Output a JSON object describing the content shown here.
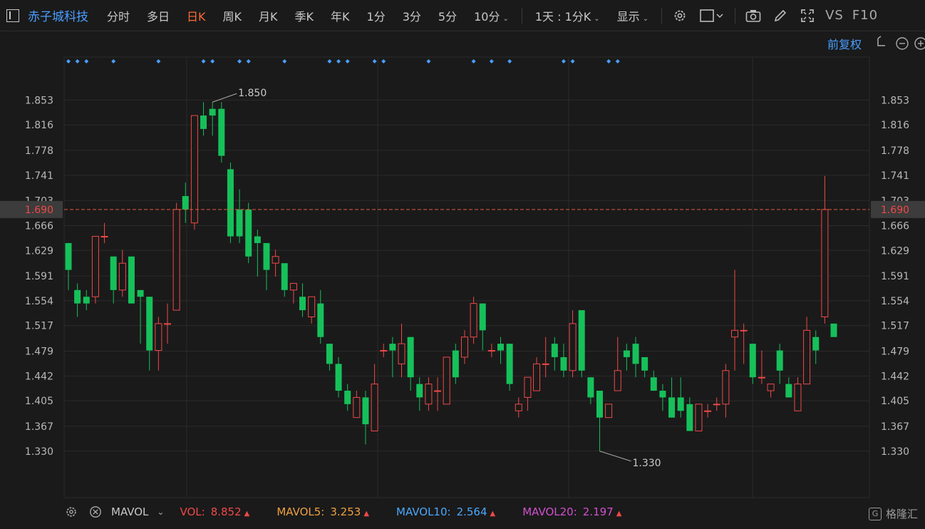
{
  "toolbar": {
    "stock_name": "赤子城科技",
    "periods": [
      "分时",
      "多日",
      "日K",
      "周K",
      "月K",
      "季K",
      "年K",
      "1分",
      "3分",
      "5分",
      "10分"
    ],
    "active_period": "日K",
    "range_select": "1天 : 1分K",
    "display_label": "显示",
    "vs_label": "VS",
    "f10_label": "F10"
  },
  "chart_header": {
    "adjust_label": "前复权"
  },
  "chart_data": {
    "type": "candlestick",
    "y_ticks": [
      1.33,
      1.367,
      1.405,
      1.442,
      1.479,
      1.517,
      1.554,
      1.591,
      1.629,
      1.666,
      1.703,
      1.741,
      1.778,
      1.816,
      1.853
    ],
    "ylim": [
      1.3,
      1.88
    ],
    "current_price": 1.69,
    "current_price_label": "1.690",
    "high_label": "1.850",
    "low_label": "1.330",
    "grid": true,
    "candles": [
      {
        "o": 1.64,
        "h": 1.64,
        "l": 1.57,
        "c": 1.6
      },
      {
        "o": 1.57,
        "h": 1.58,
        "l": 1.53,
        "c": 1.55
      },
      {
        "o": 1.56,
        "h": 1.57,
        "l": 1.54,
        "c": 1.55
      },
      {
        "o": 1.56,
        "h": 1.65,
        "l": 1.55,
        "c": 1.65
      },
      {
        "o": 1.65,
        "h": 1.67,
        "l": 1.64,
        "c": 1.65
      },
      {
        "o": 1.62,
        "h": 1.62,
        "l": 1.55,
        "c": 1.57
      },
      {
        "o": 1.57,
        "h": 1.63,
        "l": 1.56,
        "c": 1.61
      },
      {
        "o": 1.62,
        "h": 1.62,
        "l": 1.55,
        "c": 1.55
      },
      {
        "o": 1.57,
        "h": 1.57,
        "l": 1.49,
        "c": 1.56
      },
      {
        "o": 1.56,
        "h": 1.56,
        "l": 1.45,
        "c": 1.48
      },
      {
        "o": 1.48,
        "h": 1.53,
        "l": 1.45,
        "c": 1.52
      },
      {
        "o": 1.52,
        "h": 1.55,
        "l": 1.49,
        "c": 1.52
      },
      {
        "o": 1.54,
        "h": 1.7,
        "l": 1.54,
        "c": 1.69
      },
      {
        "o": 1.71,
        "h": 1.73,
        "l": 1.67,
        "c": 1.69
      },
      {
        "o": 1.67,
        "h": 1.83,
        "l": 1.66,
        "c": 1.83
      },
      {
        "o": 1.83,
        "h": 1.85,
        "l": 1.8,
        "c": 1.81
      },
      {
        "o": 1.84,
        "h": 1.85,
        "l": 1.8,
        "c": 1.83
      },
      {
        "o": 1.84,
        "h": 1.85,
        "l": 1.76,
        "c": 1.77
      },
      {
        "o": 1.75,
        "h": 1.76,
        "l": 1.64,
        "c": 1.65
      },
      {
        "o": 1.69,
        "h": 1.72,
        "l": 1.64,
        "c": 1.65
      },
      {
        "o": 1.69,
        "h": 1.7,
        "l": 1.61,
        "c": 1.62
      },
      {
        "o": 1.65,
        "h": 1.66,
        "l": 1.59,
        "c": 1.64
      },
      {
        "o": 1.64,
        "h": 1.64,
        "l": 1.57,
        "c": 1.6
      },
      {
        "o": 1.61,
        "h": 1.63,
        "l": 1.59,
        "c": 1.62
      },
      {
        "o": 1.61,
        "h": 1.61,
        "l": 1.56,
        "c": 1.57
      },
      {
        "o": 1.57,
        "h": 1.58,
        "l": 1.55,
        "c": 1.58
      },
      {
        "o": 1.56,
        "h": 1.58,
        "l": 1.53,
        "c": 1.54
      },
      {
        "o": 1.53,
        "h": 1.56,
        "l": 1.52,
        "c": 1.56
      },
      {
        "o": 1.55,
        "h": 1.57,
        "l": 1.49,
        "c": 1.5
      },
      {
        "o": 1.49,
        "h": 1.49,
        "l": 1.45,
        "c": 1.46
      },
      {
        "o": 1.46,
        "h": 1.47,
        "l": 1.41,
        "c": 1.42
      },
      {
        "o": 1.42,
        "h": 1.43,
        "l": 1.39,
        "c": 1.4
      },
      {
        "o": 1.38,
        "h": 1.42,
        "l": 1.38,
        "c": 1.41
      },
      {
        "o": 1.41,
        "h": 1.42,
        "l": 1.34,
        "c": 1.37
      },
      {
        "o": 1.36,
        "h": 1.46,
        "l": 1.36,
        "c": 1.43
      },
      {
        "o": 1.48,
        "h": 1.49,
        "l": 1.47,
        "c": 1.48
      },
      {
        "o": 1.49,
        "h": 1.5,
        "l": 1.44,
        "c": 1.48
      },
      {
        "o": 1.46,
        "h": 1.52,
        "l": 1.44,
        "c": 1.49
      },
      {
        "o": 1.5,
        "h": 1.5,
        "l": 1.42,
        "c": 1.44
      },
      {
        "o": 1.43,
        "h": 1.44,
        "l": 1.39,
        "c": 1.41
      },
      {
        "o": 1.4,
        "h": 1.44,
        "l": 1.39,
        "c": 1.43
      },
      {
        "o": 1.42,
        "h": 1.44,
        "l": 1.39,
        "c": 1.42
      },
      {
        "o": 1.4,
        "h": 1.46,
        "l": 1.4,
        "c": 1.47
      },
      {
        "o": 1.48,
        "h": 1.49,
        "l": 1.43,
        "c": 1.44
      },
      {
        "o": 1.47,
        "h": 1.51,
        "l": 1.46,
        "c": 1.5
      },
      {
        "o": 1.5,
        "h": 1.56,
        "l": 1.49,
        "c": 1.55
      },
      {
        "o": 1.55,
        "h": 1.55,
        "l": 1.48,
        "c": 1.51
      },
      {
        "o": 1.48,
        "h": 1.49,
        "l": 1.47,
        "c": 1.48
      },
      {
        "o": 1.49,
        "h": 1.5,
        "l": 1.46,
        "c": 1.48
      },
      {
        "o": 1.49,
        "h": 1.49,
        "l": 1.42,
        "c": 1.43
      },
      {
        "o": 1.39,
        "h": 1.41,
        "l": 1.38,
        "c": 1.4
      },
      {
        "o": 1.41,
        "h": 1.44,
        "l": 1.39,
        "c": 1.44
      },
      {
        "o": 1.42,
        "h": 1.47,
        "l": 1.42,
        "c": 1.46
      },
      {
        "o": 1.46,
        "h": 1.5,
        "l": 1.44,
        "c": 1.46
      },
      {
        "o": 1.49,
        "h": 1.5,
        "l": 1.45,
        "c": 1.47
      },
      {
        "o": 1.47,
        "h": 1.49,
        "l": 1.44,
        "c": 1.45
      },
      {
        "o": 1.45,
        "h": 1.54,
        "l": 1.44,
        "c": 1.52
      },
      {
        "o": 1.54,
        "h": 1.54,
        "l": 1.44,
        "c": 1.45
      },
      {
        "o": 1.44,
        "h": 1.44,
        "l": 1.4,
        "c": 1.41
      },
      {
        "o": 1.42,
        "h": 1.42,
        "l": 1.33,
        "c": 1.38
      },
      {
        "o": 1.38,
        "h": 1.4,
        "l": 1.38,
        "c": 1.4
      },
      {
        "o": 1.42,
        "h": 1.5,
        "l": 1.42,
        "c": 1.45
      },
      {
        "o": 1.48,
        "h": 1.49,
        "l": 1.45,
        "c": 1.47
      },
      {
        "o": 1.49,
        "h": 1.5,
        "l": 1.44,
        "c": 1.46
      },
      {
        "o": 1.47,
        "h": 1.47,
        "l": 1.44,
        "c": 1.45
      },
      {
        "o": 1.44,
        "h": 1.45,
        "l": 1.42,
        "c": 1.42
      },
      {
        "o": 1.42,
        "h": 1.43,
        "l": 1.39,
        "c": 1.41
      },
      {
        "o": 1.41,
        "h": 1.44,
        "l": 1.38,
        "c": 1.38
      },
      {
        "o": 1.41,
        "h": 1.44,
        "l": 1.38,
        "c": 1.39
      },
      {
        "o": 1.4,
        "h": 1.41,
        "l": 1.36,
        "c": 1.36
      },
      {
        "o": 1.36,
        "h": 1.4,
        "l": 1.36,
        "c": 1.4
      },
      {
        "o": 1.39,
        "h": 1.4,
        "l": 1.38,
        "c": 1.39
      },
      {
        "o": 1.4,
        "h": 1.41,
        "l": 1.39,
        "c": 1.4
      },
      {
        "o": 1.4,
        "h": 1.46,
        "l": 1.38,
        "c": 1.45
      },
      {
        "o": 1.5,
        "h": 1.6,
        "l": 1.45,
        "c": 1.51
      },
      {
        "o": 1.51,
        "h": 1.52,
        "l": 1.46,
        "c": 1.51
      },
      {
        "o": 1.49,
        "h": 1.49,
        "l": 1.43,
        "c": 1.44
      },
      {
        "o": 1.44,
        "h": 1.48,
        "l": 1.43,
        "c": 1.44
      },
      {
        "o": 1.42,
        "h": 1.42,
        "l": 1.41,
        "c": 1.43
      },
      {
        "o": 1.48,
        "h": 1.49,
        "l": 1.43,
        "c": 1.45
      },
      {
        "o": 1.43,
        "h": 1.44,
        "l": 1.41,
        "c": 1.41
      },
      {
        "o": 1.39,
        "h": 1.44,
        "l": 1.39,
        "c": 1.43
      },
      {
        "o": 1.43,
        "h": 1.53,
        "l": 1.43,
        "c": 1.51
      },
      {
        "o": 1.5,
        "h": 1.51,
        "l": 1.46,
        "c": 1.48
      },
      {
        "o": 1.53,
        "h": 1.74,
        "l": 1.52,
        "c": 1.69
      },
      {
        "o": 1.52,
        "h": 1.52,
        "l": 1.5,
        "c": 1.5
      }
    ]
  },
  "volume_bar": {
    "name": "MAVOL",
    "vol_label": "VOL:",
    "vol_value": "8.852",
    "mavol5_label": "MAVOL5:",
    "mavol5_value": "3.253",
    "mavol10_label": "MAVOL10:",
    "mavol10_value": "2.564",
    "mavol20_label": "MAVOL20:",
    "mavol20_value": "2.197",
    "colors": {
      "vol": "#f04848",
      "mavol5": "#f0a040",
      "mavol10": "#4aa8ff",
      "mavol20": "#d050d0"
    }
  },
  "watermark": {
    "text": "格隆汇",
    "icon_letter": "G"
  },
  "colors": {
    "up": "#f04848",
    "down": "#16c05a",
    "accent": "#4a9eff",
    "active": "#ff6b35",
    "marker": "#4a9eff"
  }
}
